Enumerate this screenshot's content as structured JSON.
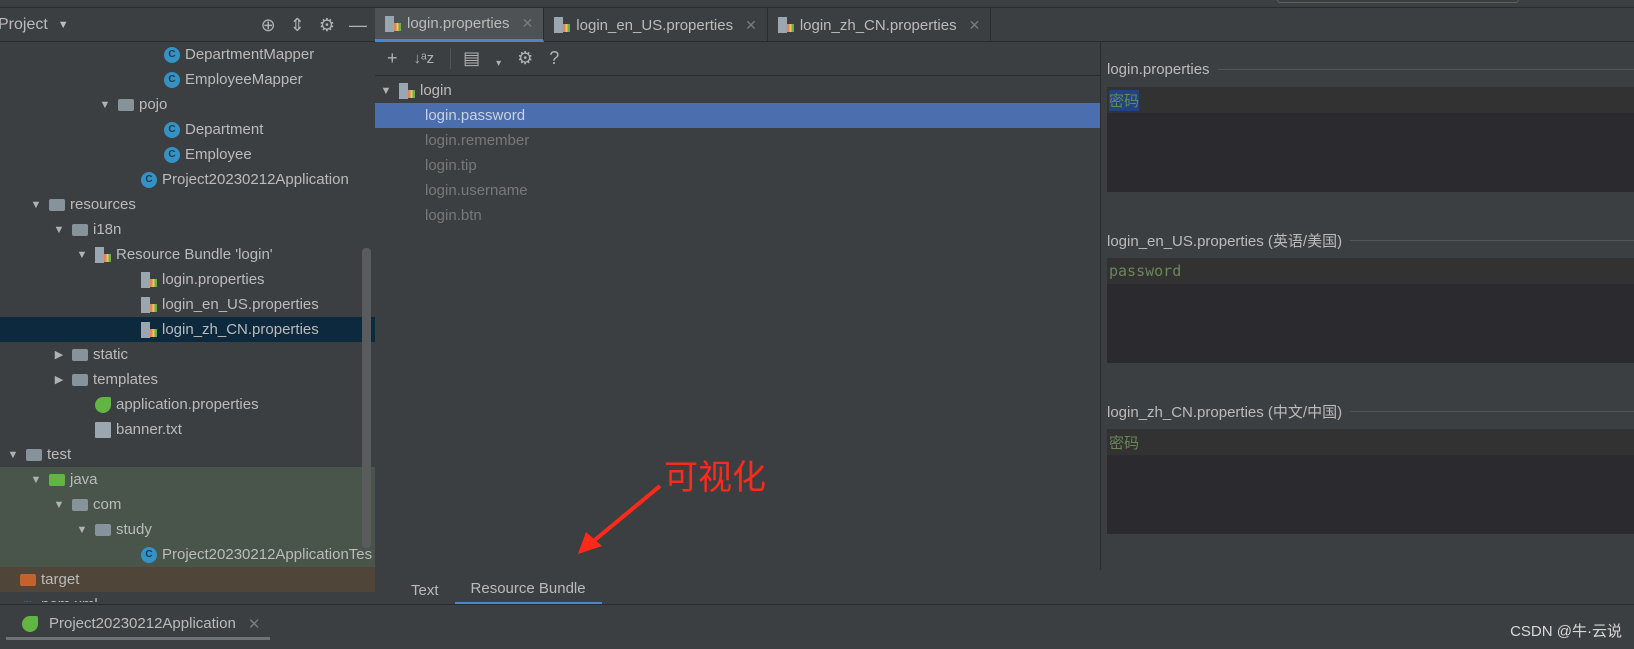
{
  "project_panel": {
    "title": "Project",
    "icons": [
      "locate-icon",
      "collapse-all-icon",
      "gear-icon",
      "minimize-icon"
    ]
  },
  "tree": [
    {
      "label": "DepartmentMapper",
      "level": 6,
      "icon": "class",
      "arrow": ""
    },
    {
      "label": "EmployeeMapper",
      "level": 6,
      "icon": "class",
      "arrow": ""
    },
    {
      "label": "pojo",
      "level": 4,
      "icon": "package",
      "arrow": "down"
    },
    {
      "label": "Department",
      "level": 6,
      "icon": "class",
      "arrow": ""
    },
    {
      "label": "Employee",
      "level": 6,
      "icon": "class",
      "arrow": ""
    },
    {
      "label": "Project20230212Application",
      "level": 5,
      "icon": "spring-class",
      "arrow": ""
    },
    {
      "label": "resources",
      "level": 1,
      "icon": "resources-folder",
      "arrow": "down"
    },
    {
      "label": "i18n",
      "level": 2,
      "icon": "folder",
      "arrow": "down"
    },
    {
      "label": "Resource Bundle 'login'",
      "level": 3,
      "icon": "bundle",
      "arrow": "down"
    },
    {
      "label": "login.properties",
      "level": 5,
      "icon": "properties",
      "arrow": ""
    },
    {
      "label": "login_en_US.properties",
      "level": 5,
      "icon": "properties",
      "arrow": ""
    },
    {
      "label": "login_zh_CN.properties",
      "level": 5,
      "icon": "properties",
      "arrow": "",
      "selected": true
    },
    {
      "label": "static",
      "level": 2,
      "icon": "folder",
      "arrow": "right"
    },
    {
      "label": "templates",
      "level": 2,
      "icon": "folder",
      "arrow": "right"
    },
    {
      "label": "application.properties",
      "level": 3,
      "icon": "spring-properties",
      "arrow": ""
    },
    {
      "label": "banner.txt",
      "level": 3,
      "icon": "text",
      "arrow": ""
    },
    {
      "label": "test",
      "level": 0,
      "icon": "folder",
      "arrow": "down"
    },
    {
      "label": "java",
      "level": 1,
      "icon": "test-folder",
      "arrow": "down",
      "highlight": "green"
    },
    {
      "label": "com",
      "level": 2,
      "icon": "package",
      "arrow": "down",
      "highlight": "green"
    },
    {
      "label": "study",
      "level": 3,
      "icon": "package",
      "arrow": "down",
      "highlight": "green"
    },
    {
      "label": "Project20230212ApplicationTes",
      "level": 5,
      "icon": "class",
      "arrow": "",
      "highlight": "green"
    },
    {
      "label": "target",
      "level": -1,
      "icon": "excluded-folder",
      "arrow": "",
      "highlight": "brown"
    },
    {
      "label": "pom.xml",
      "level": -1,
      "icon": "maven",
      "arrow": ""
    }
  ],
  "editor_tabs": [
    {
      "label": "login.properties",
      "active": true
    },
    {
      "label": "login_en_US.properties"
    },
    {
      "label": "login_zh_CN.properties"
    }
  ],
  "toolbar": {
    "icons": [
      "add-icon",
      "sort-alpha-icon",
      "group-icon",
      "dropdown-icon",
      "gear-icon",
      "help-icon"
    ],
    "help": "?"
  },
  "bundle": {
    "root": "login",
    "keys": [
      {
        "key": "login.password",
        "selected": true
      },
      {
        "key": "login.remember"
      },
      {
        "key": "login.tip"
      },
      {
        "key": "login.username"
      },
      {
        "key": "login.btn"
      }
    ]
  },
  "values": [
    {
      "file": "login.properties",
      "value": "密码",
      "highlight": true
    },
    {
      "file": "login_en_US.properties (英语/美国)",
      "value": "password"
    },
    {
      "file": "login_zh_CN.properties (中文/中国)",
      "value": "密码"
    }
  ],
  "bottom_tabs": [
    {
      "label": "Text"
    },
    {
      "label": "Resource Bundle",
      "active": true
    }
  ],
  "run_tab": {
    "label": "Project20230212Application"
  },
  "annotation": {
    "text": "可视化",
    "color": "#ff2a1a"
  },
  "watermark": "CSDN @牛·云说",
  "colors": {
    "background": "#3c3f41",
    "selection": "#4b6eaf",
    "value_text": "#6a8759",
    "accent": "#4a88c7"
  }
}
